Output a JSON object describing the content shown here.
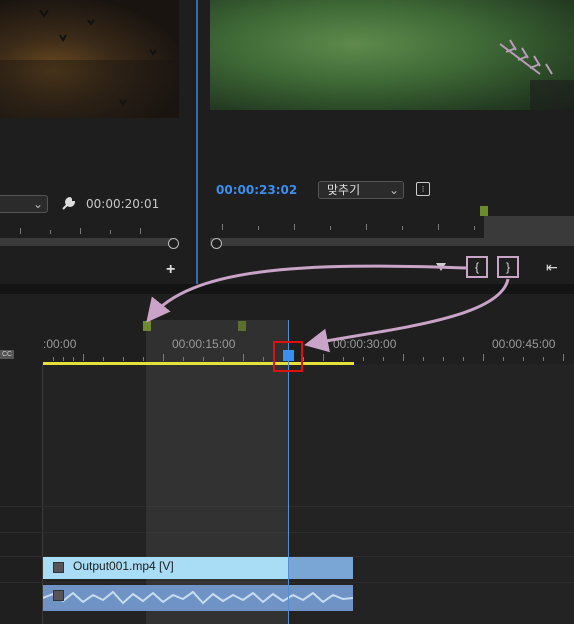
{
  "source_monitor": {
    "timecode": "00:00:20:01",
    "wrench_icon": "wrench-icon",
    "add_icon": "+"
  },
  "program_monitor": {
    "timecode": "00:00:23:02",
    "fit_label": "맞추기",
    "fit_chevron": "⌄",
    "export_frame_glyph": "⊡",
    "mark_in_glyph": "{",
    "mark_out_glyph": "}",
    "go_in_glyph": "⇤"
  },
  "timeline": {
    "ruler_labels": [
      ":00:00",
      "00:00:15:00",
      "00:00:30:00",
      "00:00:45:00"
    ],
    "cc_label": "CC",
    "video_clip_name": "Output001.mp4 [V]"
  },
  "colors": {
    "playhead": "#3a8ff0",
    "annotation_arrow": "#caa4c8",
    "highlight_box": "#e01010",
    "work_area_bar": "#e6e03a"
  }
}
